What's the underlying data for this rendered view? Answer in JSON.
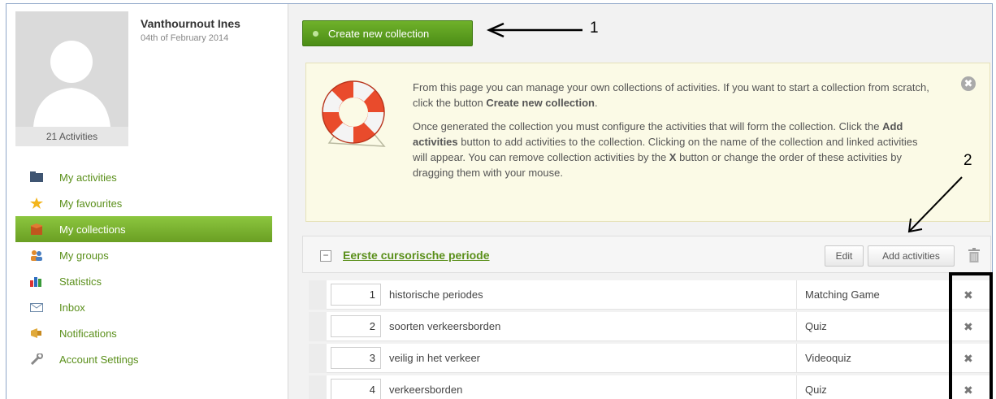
{
  "profile": {
    "name": "Vanthournout Ines",
    "date": "04th of February 2014",
    "activity_count": "21 Activities"
  },
  "nav": [
    {
      "label": "My activities",
      "icon": "folder-icon",
      "active": false
    },
    {
      "label": "My favourites",
      "icon": "star-icon",
      "active": false
    },
    {
      "label": "My collections",
      "icon": "box-icon",
      "active": true
    },
    {
      "label": "My groups",
      "icon": "group-icon",
      "active": false
    },
    {
      "label": "Statistics",
      "icon": "bar-chart-icon",
      "active": false
    },
    {
      "label": "Inbox",
      "icon": "envelope-icon",
      "active": false
    },
    {
      "label": "Notifications",
      "icon": "megaphone-icon",
      "active": false
    },
    {
      "label": "Account Settings",
      "icon": "wrench-icon",
      "active": false
    }
  ],
  "main": {
    "create_label": "Create new collection"
  },
  "info": {
    "p1_a": "From this page you can manage your own collections of activities. If you want to start a collection from scratch, click the button ",
    "p1_b": "Create new collection",
    "p1_c": ".",
    "p2_a": "Once generated the collection you must configure the activities that will form the collection. Click the ",
    "p2_b": "Add activities",
    "p2_c": " button to add activities to the collection. Clicking on the name of the collection and linked activities will appear. You can remove collection activities by the ",
    "p2_d": "X",
    "p2_e": " button or change the order of these activities by dragging them with your mouse.",
    "close_glyph": "✖"
  },
  "collection": {
    "title": "Eerste cursorische periode",
    "toggle_glyph": "−",
    "edit_label": "Edit",
    "add_label": "Add activities",
    "rows": [
      {
        "num": "1",
        "name": "historische periodes",
        "type": "Matching Game"
      },
      {
        "num": "2",
        "name": "soorten verkeersborden",
        "type": "Quiz"
      },
      {
        "num": "3",
        "name": "veilig in het verkeer",
        "type": "Videoquiz"
      },
      {
        "num": "4",
        "name": "verkeersborden",
        "type": "Quiz"
      }
    ],
    "remove_glyph": "✖"
  },
  "annotations": {
    "label_1": "1",
    "label_2": "2"
  },
  "colors": {
    "accent_green": "#6a9f23",
    "link_green": "#5a8f1a",
    "info_bg": "#fbfae6"
  }
}
